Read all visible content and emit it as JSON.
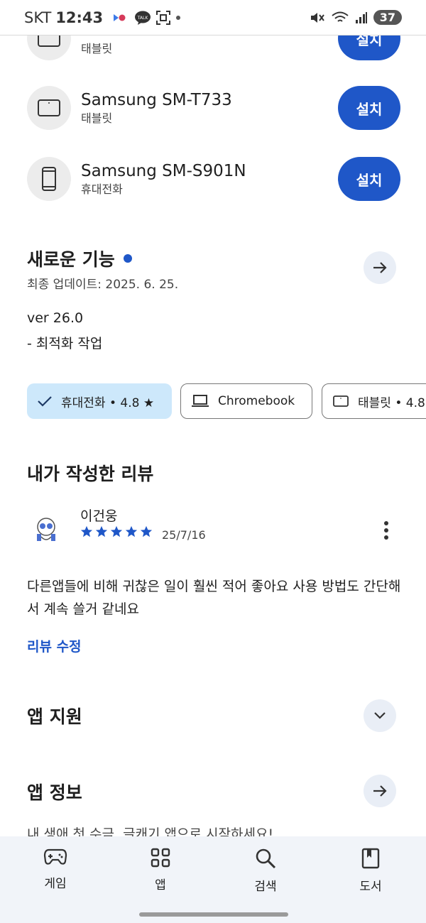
{
  "status_bar": {
    "carrier": "SKT",
    "time": "12:43",
    "battery": "37"
  },
  "devices": [
    {
      "type_label": "태블릿",
      "install_label": "설치"
    },
    {
      "name": "Samsung SM-T733",
      "type_label": "태블릿",
      "install_label": "설치"
    },
    {
      "name": "Samsung SM-S901N",
      "type_label": "휴대전화",
      "install_label": "설치"
    }
  ],
  "whats_new": {
    "title": "새로운 기능",
    "updated": "최종 업데이트: 2025. 6. 25.",
    "version": "ver 26.0",
    "note": "- 최적화 작업"
  },
  "chips": [
    {
      "label": "휴대전화 • 4.8 ★",
      "selected": true
    },
    {
      "label": "Chromebook",
      "selected": false
    },
    {
      "label": "태블릿 • 4.8",
      "selected": false
    }
  ],
  "my_review": {
    "title": "내가 작성한 리뷰",
    "reviewer": "이건웅",
    "rating": 5,
    "date": "25/7/16",
    "text": "다른앱들에 비해 귀찮은 일이 훨씬 적어 좋아요 사용 방법도 간단해서 계속 쓸거 같네요",
    "edit_label": "리뷰 수정"
  },
  "app_support": {
    "title": "앱 지원"
  },
  "app_info": {
    "title": "앱 정보",
    "teaser": "내 생애 첫 수금, 글캐기 앱으로 시작하세요!"
  },
  "bottom_nav": [
    {
      "label": "게임",
      "icon": "gamepad-icon"
    },
    {
      "label": "앱",
      "icon": "apps-grid-icon"
    },
    {
      "label": "검색",
      "icon": "search-icon"
    },
    {
      "label": "도서",
      "icon": "book-icon"
    }
  ],
  "colors": {
    "accent": "#1f57c8",
    "chip_selected_bg": "#cde8fb",
    "nav_bg": "#f1f4f9"
  }
}
